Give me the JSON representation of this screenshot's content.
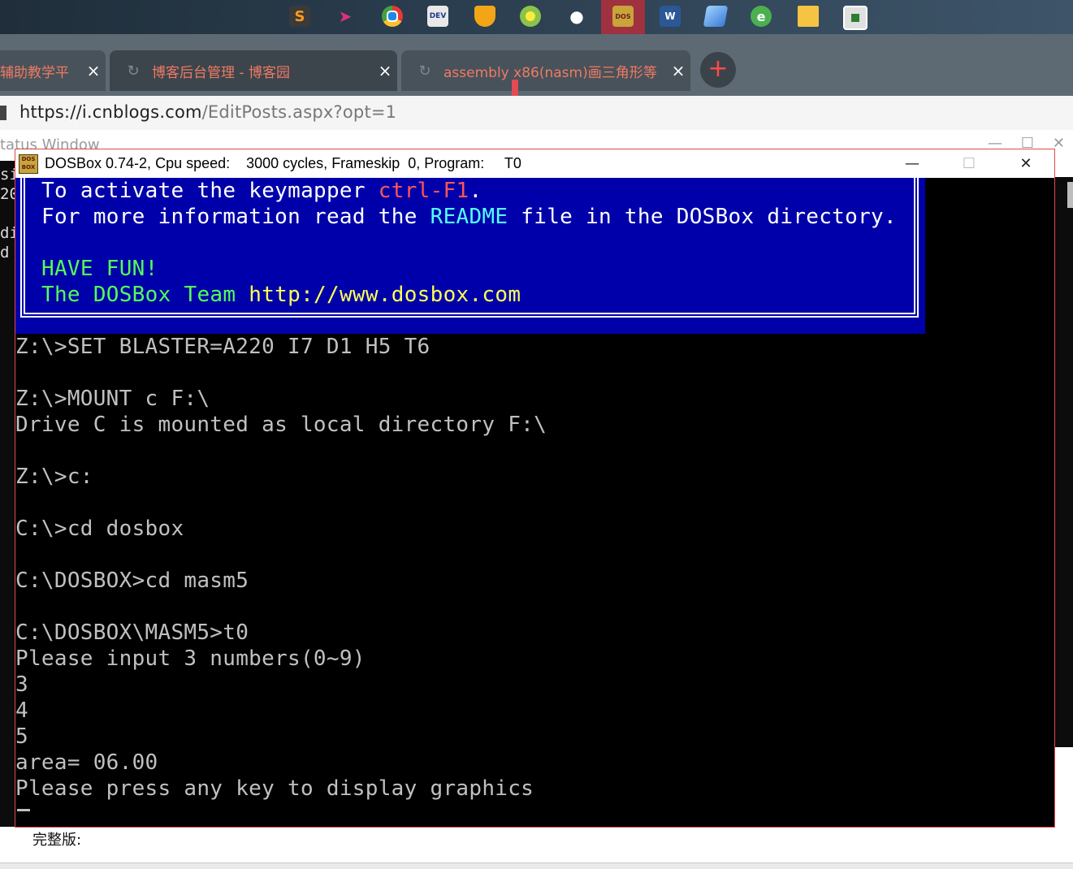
{
  "taskbar": {
    "icons": [
      "sublime-icon",
      "paper-plane-icon",
      "chrome-icon",
      "dev-cpp-icon",
      "shield-icon",
      "green-app-icon",
      "qq-penguin-icon",
      "dosbox-icon",
      "word-icon",
      "notepad-icon",
      "ie-icon",
      "folder-icon",
      "screen-icon"
    ],
    "labels": {
      "dev": "DEV",
      "word": "W",
      "dosbox": "DOS"
    }
  },
  "browser": {
    "tabs": [
      {
        "title": "辅助教学平",
        "close": "×"
      },
      {
        "title": "博客后台管理 - 博客园",
        "close": "×"
      },
      {
        "title": "assembly x86(nasm)画三角形等",
        "close": "×"
      }
    ],
    "new_tab": "+",
    "url_host": "https://i.cnblogs.com",
    "url_path": "/EditPosts.aspx?opt=1"
  },
  "status_window": {
    "title": "tatus Window",
    "left_lines": [
      "si",
      "20",
      "di",
      "d"
    ],
    "bottom_text": "完整版:"
  },
  "dosbox": {
    "title": "DOSBox 0.74-2, Cpu speed:    3000 cycles, Frameskip  0, Program:     T0",
    "logo_text": "DOS BOX",
    "controls": {
      "minimize": "—",
      "maximize": "☐",
      "close": "✕"
    },
    "banner": {
      "line1_a": "To activate the keymapper ",
      "line1_b": "ctrl-F1",
      "line1_c": ".",
      "line2_a": "For more information read the ",
      "line2_b": "README",
      "line2_c": " file in the DOSBox directory.",
      "line3": "HAVE FUN!",
      "line4_a": "The DOSBox Team ",
      "line4_b": "http://www.dosbox.com"
    },
    "console": [
      "Z:\\>SET BLASTER=A220 I7 D1 H5 T6",
      "",
      "Z:\\>MOUNT c F:\\",
      "Drive C is mounted as local directory F:\\",
      "",
      "Z:\\>c:",
      "",
      "C:\\>cd dosbox",
      "",
      "C:\\DOSBOX>cd masm5",
      "",
      "C:\\DOSBOX\\MASM5>t0",
      "Please input 3 numbers(0~9)",
      "3",
      "4",
      "5",
      "area= 06.00",
      "Please press any key to display graphics"
    ]
  }
}
